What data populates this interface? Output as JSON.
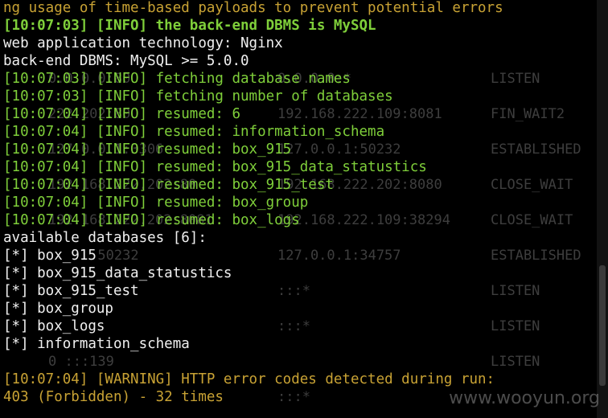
{
  "terminal": {
    "lines": [
      {
        "text": "ng usage of time-based payloads to prevent potential errors",
        "color": "#c8a234"
      },
      {
        "text": "[10:07:03] [INFO] the back-end DBMS is MySQL",
        "color": "#7fcf3a"
      },
      {
        "text": "web application technology: Nginx",
        "color": "#f0f0f0"
      },
      {
        "text": "back-end DBMS: MySQL >= 5.0.0",
        "color": "#f0f0f0"
      },
      {
        "text": "[10:07:03] [INFO] fetching database names",
        "color": "#7fcf3a"
      },
      {
        "text": "[10:07:03] [INFO] fetching number of databases",
        "color": "#7fcf3a"
      },
      {
        "text": "[10:07:04] [INFO] resumed: 6",
        "color": "#7fcf3a"
      },
      {
        "text": "[10:07:04] [INFO] resumed: information_schema",
        "color": "#7fcf3a"
      },
      {
        "text": "[10:07:04] [INFO] resumed: box_915",
        "color": "#7fcf3a"
      },
      {
        "text": "[10:07:04] [INFO] resumed: box_915_data_statustics",
        "color": "#7fcf3a"
      },
      {
        "text": "[10:07:04] [INFO] resumed: box_915_test",
        "color": "#7fcf3a"
      },
      {
        "text": "[10:07:04] [INFO] resumed: box_group",
        "color": "#7fcf3a"
      },
      {
        "text": "[10:07:04] [INFO] resumed: box_logs",
        "color": "#7fcf3a"
      },
      {
        "text": "available databases [6]:",
        "color": "#f0f0f0"
      },
      {
        "text": "[*] box_915",
        "color": "#f0f0f0"
      },
      {
        "text": "[*] box_915_data_statustics",
        "color": "#f0f0f0"
      },
      {
        "text": "[*] box_915_test",
        "color": "#f0f0f0"
      },
      {
        "text": "[*] box_group",
        "color": "#f0f0f0"
      },
      {
        "text": "[*] box_logs",
        "color": "#f0f0f0"
      },
      {
        "text": "[*] information_schema",
        "color": "#f0f0f0"
      },
      {
        "text": "",
        "color": "#f0f0f0"
      },
      {
        "text": "[10:07:04] [WARNING] HTTP error codes detected during run:",
        "color": "#c8a234"
      },
      {
        "text": "403 (Forbidden) - 32 times",
        "color": "#c8a234"
      }
    ]
  },
  "background_netstat": [
    {
      "a": "0.0.0.0:80",
      "b": "0.0.0.0:*",
      "c": "LISTEN"
    },
    {
      "a": "",
      "b": "",
      "c": ""
    },
    {
      "a": "222.202:80",
      "b": "192.168.222.109:8081",
      "c": "FIN_WAIT2"
    },
    {
      "a": "",
      "b": "",
      "c": ""
    },
    {
      "a": "127.0.0.1:3306",
      "b": "127.0.0.1:50232",
      "c": "ESTABLISHED"
    },
    {
      "a": "",
      "b": "",
      "c": ""
    },
    {
      "a": "192.168.222.202:80",
      "b": "192.168.222.202:8080",
      "c": "CLOSE_WAIT"
    },
    {
      "a": "",
      "b": "",
      "c": ""
    },
    {
      "a": "192.168.222.202:8081",
      "b": "192.168.222.109:38294",
      "c": "CLOSE_WAIT"
    },
    {
      "a": "",
      "b": "",
      "c": ""
    },
    {
      "a": "0.0.1:50232",
      "b": "127.0.0.1:34757",
      "c": "ESTABLISHED"
    },
    {
      "a": "",
      "b": "",
      "c": ""
    },
    {
      "a": "",
      "b": ":::*",
      "c": "LISTEN"
    },
    {
      "a": "",
      "b": "",
      "c": ""
    },
    {
      "a": "",
      "b": ":::*",
      "c": "LISTEN"
    },
    {
      "a": "",
      "b": "",
      "c": ""
    },
    {
      "a": "0 :::139",
      "b": "",
      "c": "LISTEN"
    },
    {
      "a": "",
      "b": "",
      "c": ""
    },
    {
      "a": "",
      "b": ":::*",
      "c": ""
    }
  ],
  "watermark": "www.wooyun.org"
}
